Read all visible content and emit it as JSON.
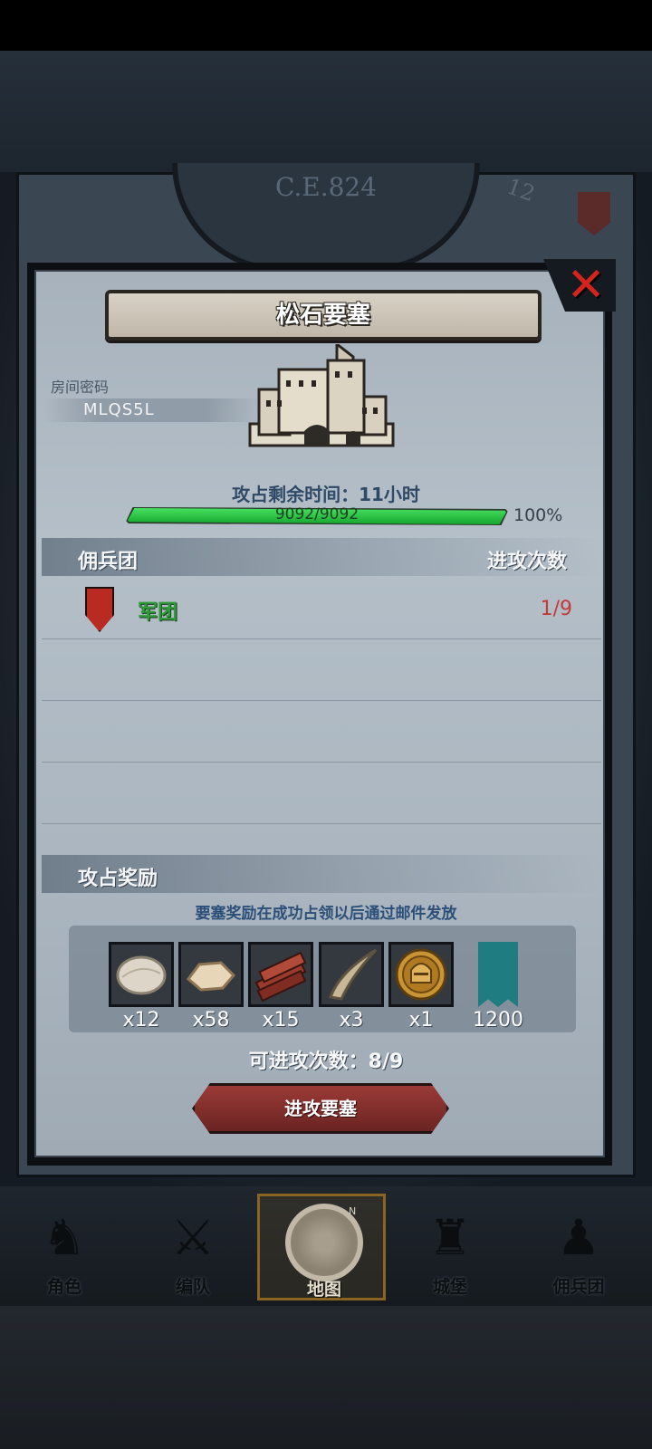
{
  "background": {
    "era_label": "C.E.824",
    "round_number": "12"
  },
  "dialog": {
    "title": "松石要塞",
    "close_icon": "close-x-icon",
    "room": {
      "label": "房间密码",
      "code": "MLQS5L"
    },
    "capture": {
      "time_label": "攻占剩余时间：11小时",
      "hp_text": "9092/9092",
      "hp_percent_text": "100%",
      "hp_fraction": 1.0
    },
    "mercenaries": {
      "header_left": "佣兵团",
      "header_right": "进攻次数",
      "rows": [
        {
          "icon": "red-shield-icon",
          "name": "军团",
          "count": "1/9"
        }
      ]
    },
    "rewards": {
      "header": "攻占奖励",
      "note": "要塞奖励在成功占领以后通过邮件发放",
      "items": [
        {
          "icon": "fur-pelt-icon",
          "qty": "x12"
        },
        {
          "icon": "leather-hide-icon",
          "qty": "x58"
        },
        {
          "icon": "wood-planks-icon",
          "qty": "x15"
        },
        {
          "icon": "horn-icon",
          "qty": "x3"
        },
        {
          "icon": "knight-helmet-coin-icon",
          "qty": "x1"
        },
        {
          "icon": "teal-banner-icon",
          "qty": "1200"
        }
      ]
    },
    "remaining_attacks": "可进攻次数：8/9",
    "attack_button": "进攻要塞"
  },
  "nav": {
    "items": [
      {
        "label": "角色",
        "icon": "character-icon",
        "active": false
      },
      {
        "label": "编队",
        "icon": "formation-icon",
        "active": false
      },
      {
        "label": "地图",
        "icon": "map-compass-icon",
        "active": true
      },
      {
        "label": "城堡",
        "icon": "castle-icon",
        "active": false
      },
      {
        "label": "佣兵团",
        "icon": "mercenary-icon",
        "active": false
      }
    ],
    "compass_letter": "N"
  },
  "colors": {
    "hp_green": "#2fbf45",
    "legion_green": "#2f9b3a",
    "count_red": "#c23a3a",
    "close_red": "#d2231c",
    "button_red": "#8a302d"
  }
}
